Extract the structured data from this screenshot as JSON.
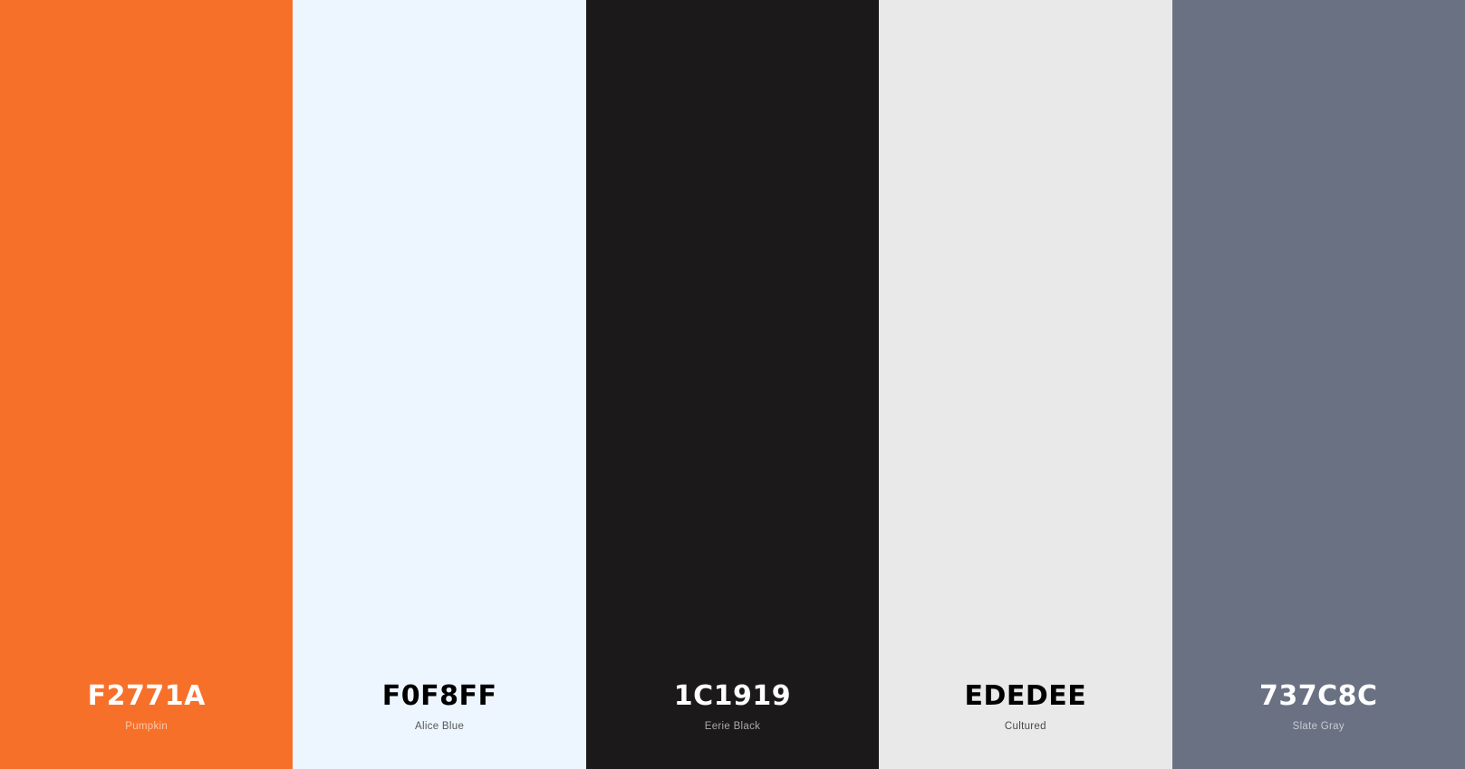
{
  "swatches": [
    {
      "hex": "F2771A",
      "name": "Pumpkin",
      "background": "#F7702A",
      "hex_color": "#FFFFFF",
      "name_color": "#FBC9A8"
    },
    {
      "hex": "F0F8FF",
      "name": "Alice Blue",
      "background": "#EDF6FE",
      "hex_color": "#000000",
      "name_color": "#555555"
    },
    {
      "hex": "1C1919",
      "name": "Eerie Black",
      "background": "#1B1919",
      "hex_color": "#FFFFFF",
      "name_color": "#A9A9A9"
    },
    {
      "hex": "EDEDEE",
      "name": "Cultured",
      "background": "#E9E9E9",
      "hex_color": "#000000",
      "name_color": "#4A4A4A"
    },
    {
      "hex": "737C8C",
      "name": "Slate Gray",
      "background": "#697183",
      "hex_color": "#FFFFFF",
      "name_color": "#C8CCD3"
    }
  ]
}
